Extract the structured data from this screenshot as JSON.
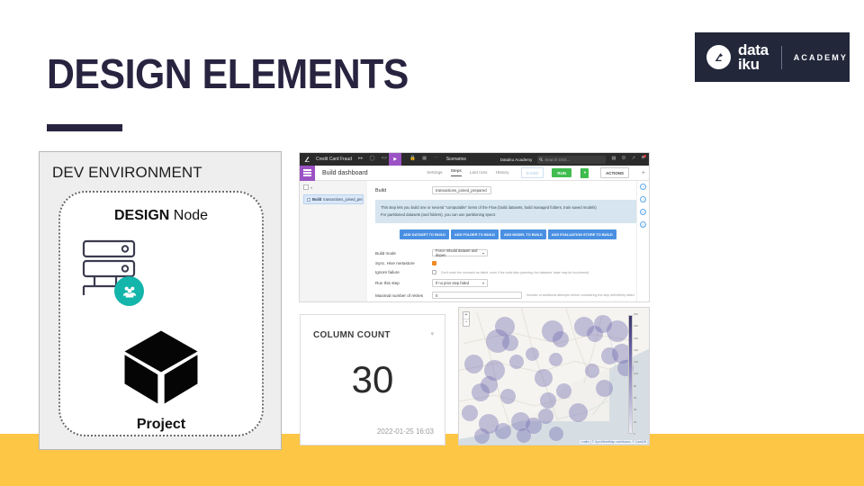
{
  "slide": {
    "title": "DESIGN ELEMENTS",
    "accent_dark": "#282440",
    "accent_yellow": "#fdc645",
    "accent_teal": "#14b5ab"
  },
  "logo": {
    "word_line1": "data",
    "word_line2": "iku",
    "academy": "ACADEMY",
    "icon": "dataiku-bird-icon",
    "background": "#22273a"
  },
  "dev_panel": {
    "title": "DEV ENVIRONMENT",
    "node_strong": "DESIGN",
    "node_rest": " Node",
    "server_icon": "server-stack-icon",
    "people_icon": "people-group-icon",
    "cube_icon": "cube-icon",
    "project_label": "Project"
  },
  "dss": {
    "topbar": {
      "logo_icon": "dataiku-logo-icon",
      "project_name": "Credit Card Fraud",
      "icons": [
        "flow-icon",
        "clock-icon",
        "code-icon"
      ],
      "play_icon": "play-icon",
      "more_icons": [
        "lock-icon",
        "grid-icon",
        "ellipsis-icon"
      ],
      "section": "Scenarios",
      "account": "Dataiku Academy",
      "search_placeholder": "Search DSS...",
      "right_icons": [
        "apps-icon",
        "help-icon",
        "activity-icon",
        "notifications-icon"
      ]
    },
    "subbar": {
      "menu_icon": "hamburger-menu-icon",
      "title": "Build dashboard",
      "tabs": [
        {
          "label": "Settings",
          "active": false
        },
        {
          "label": "Steps",
          "active": true
        },
        {
          "label": "Last runs",
          "active": false
        },
        {
          "label": "History",
          "active": false
        }
      ],
      "saved_label": "SAVED",
      "run_label": "RUN",
      "run_caret": "▾",
      "actions_label": "ACTIONS",
      "add_icon": "plus-icon"
    },
    "sidebar": {
      "step_prefix": "Build",
      "step_name": "transactions_joined_prepared",
      "menu_dots": "…"
    },
    "main": {
      "build_label": "Build",
      "build_value": "transactions_joined_prepared",
      "info_line1": "This step lets you build one or several \"computable\" items of the Flow (build datasets, build managed folders, train saved models)",
      "info_line2": "For partitioned datasets (and folders), you can use partitioning specs",
      "add_buttons": [
        "ADD DATASET TO BUILD",
        "ADD FOLDER TO BUILD",
        "ADD MODEL TO BUILD",
        "ADD EVALUATION STORE TO BUILD"
      ],
      "fields": [
        {
          "label": "Build mode",
          "value": "Force rebuild dataset and depen",
          "type": "select"
        },
        {
          "label": "Sync. Hive metastore",
          "value": "",
          "type": "checkbox-checked"
        },
        {
          "label": "Ignore failure",
          "value": "",
          "type": "checkbox",
          "hint": "Don't mark the scenario as failed, even if the build fails (warning: the datasets' state may be incoherent)"
        },
        {
          "label": "Run this step",
          "value": "If no prior step failed",
          "type": "select"
        },
        {
          "label": "Maximal number of retries",
          "value": "0",
          "type": "input",
          "hint": "Number of additional attempts before considering the step definitively failed"
        }
      ]
    },
    "rail_icons": [
      "info-circle-icon",
      "info-circle-icon",
      "info-circle-icon",
      "info-circle-icon"
    ]
  },
  "column_count_card": {
    "title": "COLUMN COUNT",
    "caret_icon": "chevron-down-icon",
    "value": "30",
    "timestamp": "2022-01-25 16:03"
  },
  "map_card": {
    "zoom_in": "+",
    "zoom_out": "−",
    "attribution": "Leaflet | © OpenStreetMap contributors, © CartoDB",
    "legend_ticks": [
      "200",
      "180",
      "160",
      "140",
      "120",
      "100",
      "80",
      "60",
      "40",
      "20",
      "0"
    ],
    "bubble_color": "#7570b3"
  }
}
